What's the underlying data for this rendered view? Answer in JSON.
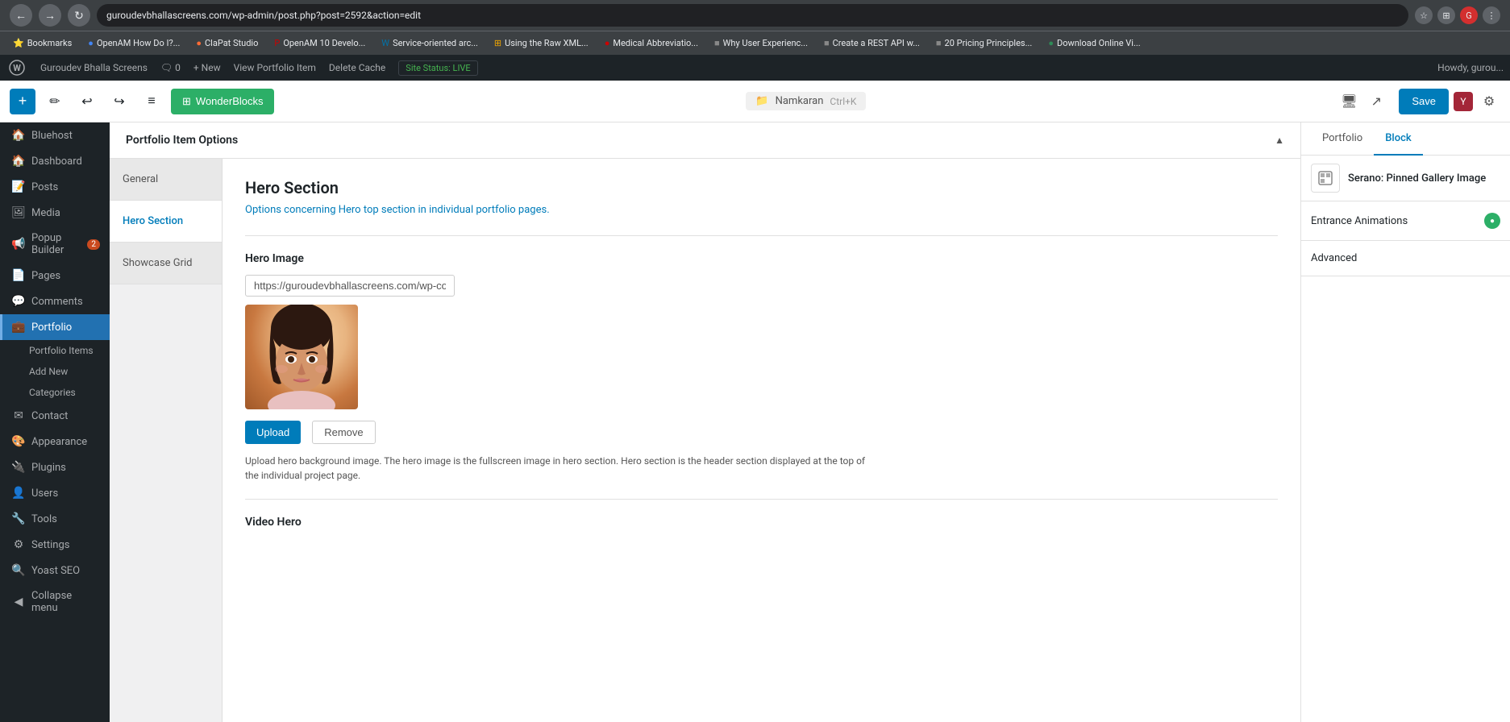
{
  "browser": {
    "url": "guroudevbhallascreens.com/wp-admin/post.php?post=2592&action=edit",
    "nav_back": "←",
    "nav_forward": "→",
    "nav_refresh": "↻",
    "bookmarks": [
      {
        "label": "Bookmarks",
        "icon": "⭐"
      },
      {
        "label": "OpenAM How Do I?...",
        "color": "#4285f4"
      },
      {
        "label": "ClaPat Studio",
        "color": "#ff6b35"
      },
      {
        "label": "OpenAM 10 Develo...",
        "color": "#cc0000"
      },
      {
        "label": "Service-oriented arc...",
        "color": "#0073aa"
      },
      {
        "label": "Using the Raw XML...",
        "color": "#f0a500"
      },
      {
        "label": "Medical Abbreviatio...",
        "color": "#cc0000"
      },
      {
        "label": "Why User Experienc...",
        "color": "#555"
      },
      {
        "label": "Create a REST API w...",
        "color": "#555"
      },
      {
        "label": "20 Pricing Principles...",
        "color": "#555"
      },
      {
        "label": "Download Online Vi...",
        "color": "#2e8b57"
      }
    ]
  },
  "wp_admin_bar": {
    "wp_logo": "W",
    "site_name": "Guroudev Bhalla Screens",
    "comments_count": "0",
    "new_label": "+ New",
    "view_portfolio": "View Portfolio Item",
    "delete_cache": "Delete Cache",
    "site_status_label": "Site Status:",
    "site_status_value": "LIVE",
    "howdy": "Howdy, gurou..."
  },
  "editor_toolbar": {
    "add_btn": "+",
    "edit_btn": "✏",
    "undo_btn": "↩",
    "redo_btn": "↪",
    "menu_btn": "≡",
    "wonderblocks_label": "WonderBlocks",
    "namkaran_label": "Namkaran",
    "shortcut": "Ctrl+K",
    "save_label": "Save"
  },
  "sidebar": {
    "items": [
      {
        "label": "Bluehost",
        "icon": "🏠",
        "active": false
      },
      {
        "label": "Dashboard",
        "icon": "🏠",
        "active": false
      },
      {
        "label": "Posts",
        "icon": "📝",
        "active": false
      },
      {
        "label": "Media",
        "icon": "🖼",
        "active": false
      },
      {
        "label": "Popup Builder",
        "icon": "📢",
        "badge": "2",
        "active": false
      },
      {
        "label": "Pages",
        "icon": "📄",
        "active": false
      },
      {
        "label": "Comments",
        "icon": "💬",
        "active": false
      },
      {
        "label": "Portfolio",
        "icon": "💼",
        "active": true
      },
      {
        "label": "Portfolio Items",
        "icon": "",
        "active": false,
        "sub": true
      },
      {
        "label": "Add New",
        "icon": "",
        "active": false,
        "sub": true
      },
      {
        "label": "Categories",
        "icon": "",
        "active": false,
        "sub": true
      },
      {
        "label": "Contact",
        "icon": "✉",
        "active": false
      },
      {
        "label": "Appearance",
        "icon": "🎨",
        "active": false
      },
      {
        "label": "Plugins",
        "icon": "🔌",
        "active": false
      },
      {
        "label": "Users",
        "icon": "👤",
        "active": false
      },
      {
        "label": "Tools",
        "icon": "🔧",
        "active": false
      },
      {
        "label": "Settings",
        "icon": "⚙",
        "active": false
      },
      {
        "label": "Yoast SEO",
        "icon": "🔍",
        "active": false
      },
      {
        "label": "Collapse menu",
        "icon": "◀",
        "active": false
      }
    ]
  },
  "portfolio_options": {
    "header": "Portfolio Item Options",
    "tabs": [
      {
        "label": "General",
        "active": false
      },
      {
        "label": "Hero Section",
        "active": true
      },
      {
        "label": "Showcase Grid",
        "active": false
      }
    ],
    "hero_section": {
      "title": "Hero Section",
      "description": "Options concerning Hero top section in individual portfolio pages.",
      "hero_image_label": "Hero Image",
      "image_url": "https://guroudevbhallascreens.com/wp-conte",
      "upload_label": "Upload",
      "remove_label": "Remove",
      "upload_desc": "Upload hero background image. The hero image is the fullscreen image in hero section. Hero section is the header section displayed at the top of the individual project page.",
      "video_hero_label": "Video Hero"
    }
  },
  "right_panel": {
    "tabs": [
      {
        "label": "Portfolio",
        "active": false
      },
      {
        "label": "Block",
        "active": true
      }
    ],
    "block_name": "Serano: Pinned Gallery Image",
    "sections": [
      {
        "label": "Entrance Animations",
        "has_dot": true
      },
      {
        "label": "Advanced",
        "has_dot": false
      }
    ]
  }
}
